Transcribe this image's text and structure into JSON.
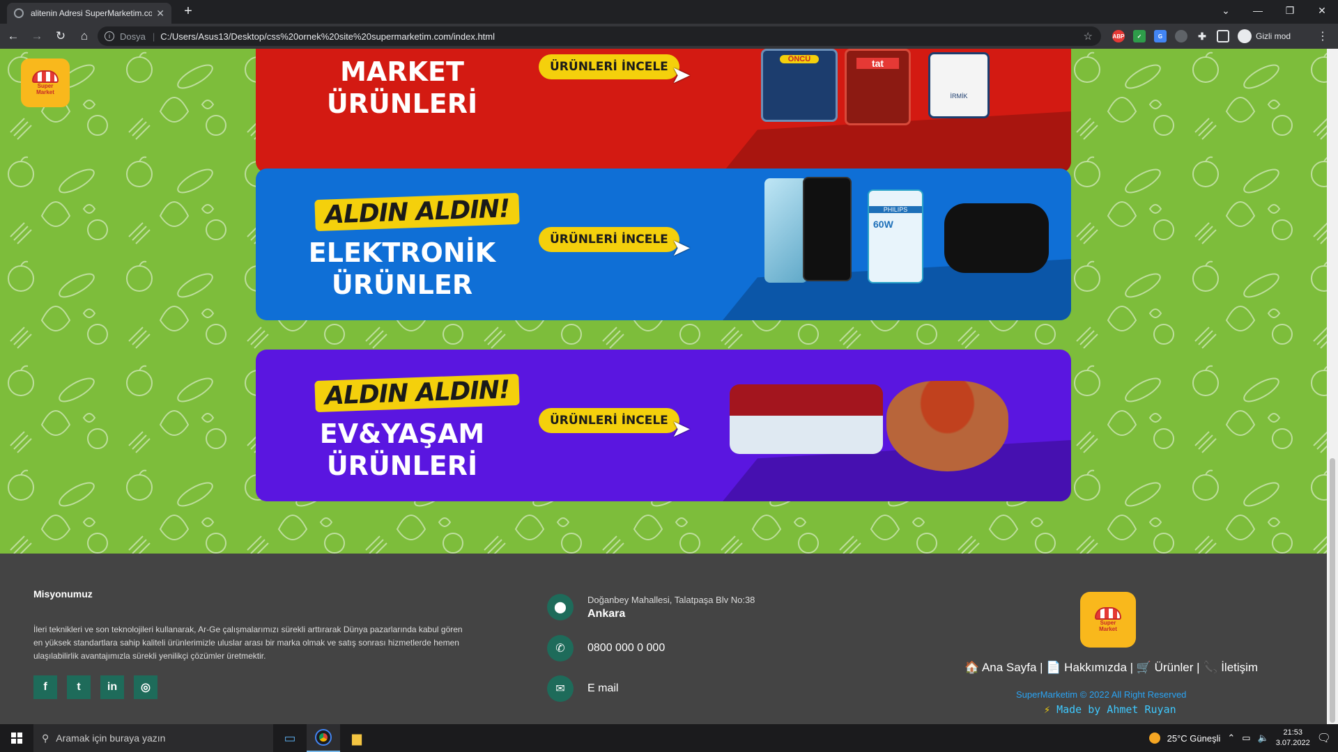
{
  "browser": {
    "tab_title": "alitenin Adresi SuperMarketim.co",
    "tab_close": "✕",
    "new_tab": "+",
    "url_scheme_label": "Dosya",
    "url": "C:/Users/Asus13/Desktop/css%20ornek%20site%20supermarketim.com/index.html",
    "profile_label": "Gizli mod",
    "window_controls": [
      "⌄",
      "—",
      "❐",
      "✕"
    ]
  },
  "logo": {
    "line1": "Super",
    "line2": "Market"
  },
  "banners": [
    {
      "badge": "",
      "title_line1": "MARKET",
      "title_line2": "ÜRÜNLERİ",
      "button": "ÜRÜNLERİ İNCELE",
      "color": "#d31a12"
    },
    {
      "badge": "ALDIN ALDIN!",
      "title_line1": "ELEKTRONİK",
      "title_line2": "ÜRÜNLER",
      "button": "ÜRÜNLERİ İNCELE",
      "color": "#0f6fd6"
    },
    {
      "badge": "ALDIN ALDIN!",
      "title_line1": "EV&YAŞAM",
      "title_line2": "ÜRÜNLERİ",
      "button": "ÜRÜNLERİ İNCELE",
      "color": "#5a16e0"
    }
  ],
  "product_labels": {
    "oncu": "ÖNCÜ",
    "tat": "tat",
    "irmik": "İRMİK",
    "philips": "PHILIPS",
    "watt": "60W"
  },
  "footer": {
    "mission_title": "Misyonumuz",
    "mission_text": "İleri teknikleri ve son teknolojileri kullanarak, Ar-Ge çalışmalarımızı sürekli arttırarak Dünya pazarlarında kabul gören en yüksek standartlara sahip kaliteli ürünlerimizle uluslar arası bir marka olmak ve satış sonrası hizmetlerde hemen ulaşılabilirlik avantajımızla sürekli yenilikçi çözümler üretmektir.",
    "socials": [
      "f",
      "t",
      "in",
      "◎"
    ],
    "address_line1": "Doğanbey Mahallesi, Talatpaşa Blv No:38",
    "address_line2": "Ankara",
    "phone": "0800 000 0 000",
    "email": "E mail",
    "links": {
      "home": "🏠 Ana Sayfa",
      "about": "📄 Hakkımızda",
      "products": "🛒 Ürünler",
      "contact": "📞 İletişim",
      "sep": " | "
    },
    "copyright": "SuperMarketim © 2022 All Right Reserved",
    "made_by": "Made by Ahmet Ruyan",
    "bolt": "⚡"
  },
  "taskbar": {
    "search_placeholder": "Aramak için buraya yazın",
    "weather": "25°C  Güneşli",
    "time": "21:53",
    "date": "3.07.2022"
  },
  "colors": {
    "page_bg": "#7dbd3b",
    "footer_bg": "#444444",
    "accent_teal": "#1e6b5a",
    "logo_yellow": "#f9b81c"
  }
}
